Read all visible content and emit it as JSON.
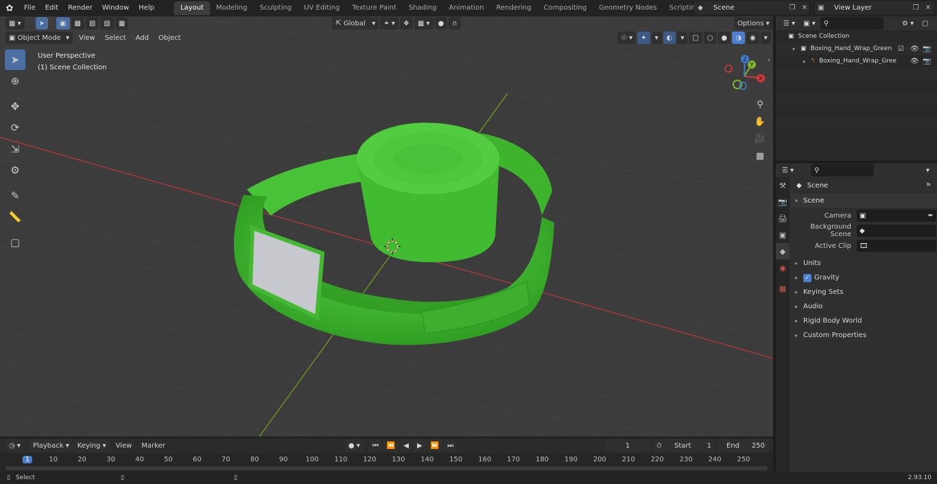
{
  "topbar": {
    "menus": [
      "File",
      "Edit",
      "Render",
      "Window",
      "Help"
    ],
    "workspaces": [
      "Layout",
      "Modeling",
      "Sculpting",
      "UV Editing",
      "Texture Paint",
      "Shading",
      "Animation",
      "Rendering",
      "Compositing",
      "Geometry Nodes",
      "Scripting"
    ],
    "active_workspace": "Layout",
    "scene_name": "Scene",
    "view_layer_name": "View Layer"
  },
  "viewport": {
    "mode": "Object Mode",
    "header_menus": [
      "View",
      "Select",
      "Add",
      "Object"
    ],
    "transform_orientation": "Global",
    "options_label": "Options",
    "perspective_label": "User Perspective",
    "collection_label": "(1) Scene Collection",
    "gizmo_axes": {
      "x": "X",
      "y": "Y",
      "z": "Z"
    }
  },
  "outliner": {
    "root": "Scene Collection",
    "items": [
      {
        "label": "Boxing_Hand_Wrap_Green"
      },
      {
        "label": "Boxing_Hand_Wrap_Gree"
      }
    ]
  },
  "properties": {
    "context_title": "Scene",
    "panel_title": "Scene",
    "fields": [
      {
        "label": "Camera",
        "value": ""
      },
      {
        "label": "Background Scene",
        "value": ""
      },
      {
        "label": "Active Clip",
        "value": ""
      }
    ],
    "subpanels": [
      {
        "label": "Units",
        "checkbox": false
      },
      {
        "label": "Gravity",
        "checkbox": true
      },
      {
        "label": "Keying Sets",
        "checkbox": false
      },
      {
        "label": "Audio",
        "checkbox": false
      },
      {
        "label": "Rigid Body World",
        "checkbox": false
      },
      {
        "label": "Custom Properties",
        "checkbox": false
      }
    ]
  },
  "timeline": {
    "menus": [
      "Playback",
      "Keying",
      "View",
      "Marker"
    ],
    "current_frame": "1",
    "start_label": "Start",
    "start_value": "1",
    "end_label": "End",
    "end_value": "250",
    "ruler": [
      "1",
      "10",
      "20",
      "30",
      "40",
      "50",
      "60",
      "70",
      "80",
      "90",
      "100",
      "110",
      "120",
      "130",
      "140",
      "150",
      "160",
      "170",
      "180",
      "190",
      "200",
      "210",
      "220",
      "230",
      "240",
      "250"
    ]
  },
  "statusbar": {
    "hint": "Select",
    "version": "2.93.10"
  },
  "colors": {
    "accent": "#4b7fd2",
    "object_green": "#3fbf2e",
    "axis_x": "#d03a3a",
    "axis_y": "#7fb52a"
  }
}
